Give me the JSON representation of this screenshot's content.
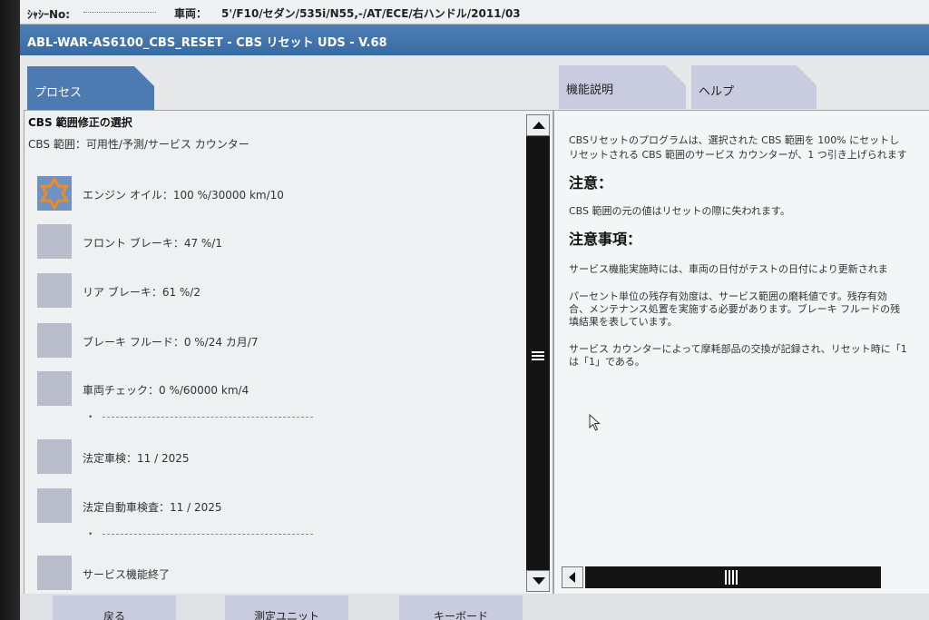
{
  "info_bar": {
    "chassis_label": "ｼｬｼｰNo:",
    "vehicle_label": "車両：",
    "vehicle_value": "5'/F10/セダン/535i/N55,-/AT/ECE/右ハンドル/2011/03"
  },
  "window_title": "ABL-WAR-AS6100_CBS_RESET - CBS リセット UDS - V.68",
  "tabs": {
    "process": "プロセス",
    "function_description": "機能説明",
    "help": "ヘルプ"
  },
  "process_panel": {
    "section_title": "CBS 範囲修正の選択",
    "section_subtitle": "CBS 範囲：可用性/予測/サービス カウンター",
    "steps": [
      {
        "label": "エンジン オイル：100 %/30000 km/10",
        "active": true
      },
      {
        "label": "フロント ブレーキ：47 %/1",
        "active": false
      },
      {
        "label": "リア ブレーキ：61 %/2",
        "active": false
      },
      {
        "label": "ブレーキ フルード：0 %/24 カ月/7",
        "active": false
      },
      {
        "label": "車両チェック：0 %/60000 km/4",
        "active": false,
        "bullet": "•"
      },
      {
        "label": "法定車検：11 / 2025",
        "active": false
      },
      {
        "label": "法定自動車検査：11 / 2025",
        "active": false,
        "bullet": "•"
      },
      {
        "label": "サービス機能終了",
        "active": false
      }
    ]
  },
  "help_panel": {
    "intro_line1": "CBSリセットのプログラムは、選択された CBS 範囲を 100% にセットし",
    "intro_line2": "リセットされる CBS 範囲のサービス カウンターが、1 つ引き上げられます",
    "caution_heading": "注意：",
    "caution_text": "CBS 範囲の元の値はリセットの際に失われます。",
    "notes_heading": "注意事項：",
    "note1": "サービス機能実施時には、車両の日付がテストの日付により更新されま",
    "note2_line1": "パーセント単位の残存有効度は、サービス範囲の磨耗値です。残存有効",
    "note2_line2": "合、メンテナンス処置を実施する必要があります。ブレーキ フルードの残",
    "note2_line3": "填結果を表しています。",
    "note3_line1": "サービス カウンターによって摩耗部品の交換が記録され、リセット時に「1",
    "note3_line2": "は「1」である。"
  },
  "bottom_buttons": {
    "back": "戻る",
    "measure_unit": "測定ユニット",
    "keyboard": "キーボード"
  },
  "colors": {
    "title_bar": "#3f70aa",
    "process_tab": "#4d7ab0",
    "inactive_tab": "#c9ccde",
    "star_orange": "#f08a24",
    "scroll_track": "#141414"
  },
  "icons": {
    "active_step": "star-icon",
    "scroll_up": "arrow-up-icon",
    "scroll_down": "arrow-down-icon",
    "scroll_left": "arrow-left-icon",
    "mouse": "mouse-cursor-icon"
  }
}
